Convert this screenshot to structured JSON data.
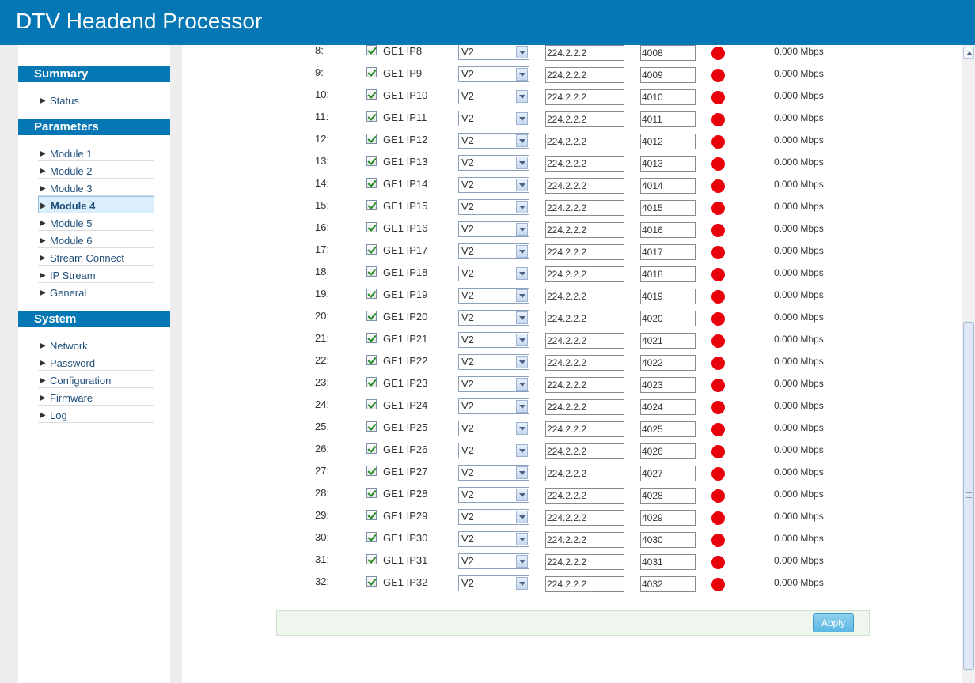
{
  "app": {
    "title": "DTV Headend Processor"
  },
  "sidebar": {
    "sections": [
      {
        "title": "Summary",
        "items": [
          {
            "label": "Status",
            "active": false
          }
        ]
      },
      {
        "title": "Parameters",
        "items": [
          {
            "label": "Module 1",
            "active": false
          },
          {
            "label": "Module 2",
            "active": false
          },
          {
            "label": "Module 3",
            "active": false
          },
          {
            "label": "Module 4",
            "active": true
          },
          {
            "label": "Module 5",
            "active": false
          },
          {
            "label": "Module 6",
            "active": false
          },
          {
            "label": "Stream Connect",
            "active": false
          },
          {
            "label": "IP Stream",
            "active": false
          },
          {
            "label": "General",
            "active": false
          }
        ]
      },
      {
        "title": "System",
        "items": [
          {
            "label": "Network",
            "active": false
          },
          {
            "label": "Password",
            "active": false
          },
          {
            "label": "Configuration",
            "active": false
          },
          {
            "label": "Firmware",
            "active": false
          },
          {
            "label": "Log",
            "active": false
          }
        ]
      }
    ]
  },
  "streams": [
    {
      "index": "8:",
      "checked": true,
      "name": "GE1 IP8",
      "version": "V2",
      "ip": "224.2.2.2",
      "port": "4008",
      "status_color": "#e8000b",
      "rate": "0.000 Mbps"
    },
    {
      "index": "9:",
      "checked": true,
      "name": "GE1 IP9",
      "version": "V2",
      "ip": "224.2.2.2",
      "port": "4009",
      "status_color": "#e8000b",
      "rate": "0.000 Mbps"
    },
    {
      "index": "10:",
      "checked": true,
      "name": "GE1 IP10",
      "version": "V2",
      "ip": "224.2.2.2",
      "port": "4010",
      "status_color": "#e8000b",
      "rate": "0.000 Mbps"
    },
    {
      "index": "11:",
      "checked": true,
      "name": "GE1 IP11",
      "version": "V2",
      "ip": "224.2.2.2",
      "port": "4011",
      "status_color": "#e8000b",
      "rate": "0.000 Mbps"
    },
    {
      "index": "12:",
      "checked": true,
      "name": "GE1 IP12",
      "version": "V2",
      "ip": "224.2.2.2",
      "port": "4012",
      "status_color": "#e8000b",
      "rate": "0.000 Mbps"
    },
    {
      "index": "13:",
      "checked": true,
      "name": "GE1 IP13",
      "version": "V2",
      "ip": "224.2.2.2",
      "port": "4013",
      "status_color": "#e8000b",
      "rate": "0.000 Mbps"
    },
    {
      "index": "14:",
      "checked": true,
      "name": "GE1 IP14",
      "version": "V2",
      "ip": "224.2.2.2",
      "port": "4014",
      "status_color": "#e8000b",
      "rate": "0.000 Mbps"
    },
    {
      "index": "15:",
      "checked": true,
      "name": "GE1 IP15",
      "version": "V2",
      "ip": "224.2.2.2",
      "port": "4015",
      "status_color": "#e8000b",
      "rate": "0.000 Mbps"
    },
    {
      "index": "16:",
      "checked": true,
      "name": "GE1 IP16",
      "version": "V2",
      "ip": "224.2.2.2",
      "port": "4016",
      "status_color": "#e8000b",
      "rate": "0.000 Mbps"
    },
    {
      "index": "17:",
      "checked": true,
      "name": "GE1 IP17",
      "version": "V2",
      "ip": "224.2.2.2",
      "port": "4017",
      "status_color": "#e8000b",
      "rate": "0.000 Mbps"
    },
    {
      "index": "18:",
      "checked": true,
      "name": "GE1 IP18",
      "version": "V2",
      "ip": "224.2.2.2",
      "port": "4018",
      "status_color": "#e8000b",
      "rate": "0.000 Mbps"
    },
    {
      "index": "19:",
      "checked": true,
      "name": "GE1 IP19",
      "version": "V2",
      "ip": "224.2.2.2",
      "port": "4019",
      "status_color": "#e8000b",
      "rate": "0.000 Mbps"
    },
    {
      "index": "20:",
      "checked": true,
      "name": "GE1 IP20",
      "version": "V2",
      "ip": "224.2.2.2",
      "port": "4020",
      "status_color": "#e8000b",
      "rate": "0.000 Mbps"
    },
    {
      "index": "21:",
      "checked": true,
      "name": "GE1 IP21",
      "version": "V2",
      "ip": "224.2.2.2",
      "port": "4021",
      "status_color": "#e8000b",
      "rate": "0.000 Mbps"
    },
    {
      "index": "22:",
      "checked": true,
      "name": "GE1 IP22",
      "version": "V2",
      "ip": "224.2.2.2",
      "port": "4022",
      "status_color": "#e8000b",
      "rate": "0.000 Mbps"
    },
    {
      "index": "23:",
      "checked": true,
      "name": "GE1 IP23",
      "version": "V2",
      "ip": "224.2.2.2",
      "port": "4023",
      "status_color": "#e8000b",
      "rate": "0.000 Mbps"
    },
    {
      "index": "24:",
      "checked": true,
      "name": "GE1 IP24",
      "version": "V2",
      "ip": "224.2.2.2",
      "port": "4024",
      "status_color": "#e8000b",
      "rate": "0.000 Mbps"
    },
    {
      "index": "25:",
      "checked": true,
      "name": "GE1 IP25",
      "version": "V2",
      "ip": "224.2.2.2",
      "port": "4025",
      "status_color": "#e8000b",
      "rate": "0.000 Mbps"
    },
    {
      "index": "26:",
      "checked": true,
      "name": "GE1 IP26",
      "version": "V2",
      "ip": "224.2.2.2",
      "port": "4026",
      "status_color": "#e8000b",
      "rate": "0.000 Mbps"
    },
    {
      "index": "27:",
      "checked": true,
      "name": "GE1 IP27",
      "version": "V2",
      "ip": "224.2.2.2",
      "port": "4027",
      "status_color": "#e8000b",
      "rate": "0.000 Mbps"
    },
    {
      "index": "28:",
      "checked": true,
      "name": "GE1 IP28",
      "version": "V2",
      "ip": "224.2.2.2",
      "port": "4028",
      "status_color": "#e8000b",
      "rate": "0.000 Mbps"
    },
    {
      "index": "29:",
      "checked": true,
      "name": "GE1 IP29",
      "version": "V2",
      "ip": "224.2.2.2",
      "port": "4029",
      "status_color": "#e8000b",
      "rate": "0.000 Mbps"
    },
    {
      "index": "30:",
      "checked": true,
      "name": "GE1 IP30",
      "version": "V2",
      "ip": "224.2.2.2",
      "port": "4030",
      "status_color": "#e8000b",
      "rate": "0.000 Mbps"
    },
    {
      "index": "31:",
      "checked": true,
      "name": "GE1 IP31",
      "version": "V2",
      "ip": "224.2.2.2",
      "port": "4031",
      "status_color": "#e8000b",
      "rate": "0.000 Mbps"
    },
    {
      "index": "32:",
      "checked": true,
      "name": "GE1 IP32",
      "version": "V2",
      "ip": "224.2.2.2",
      "port": "4032",
      "status_color": "#e8000b",
      "rate": "0.000 Mbps"
    }
  ],
  "actions": {
    "apply_label": "Apply"
  },
  "colors": {
    "header": "#0477b4",
    "accent": "#0477b4",
    "status_off": "#e8000b",
    "apply_button": "#5cb6e2"
  }
}
